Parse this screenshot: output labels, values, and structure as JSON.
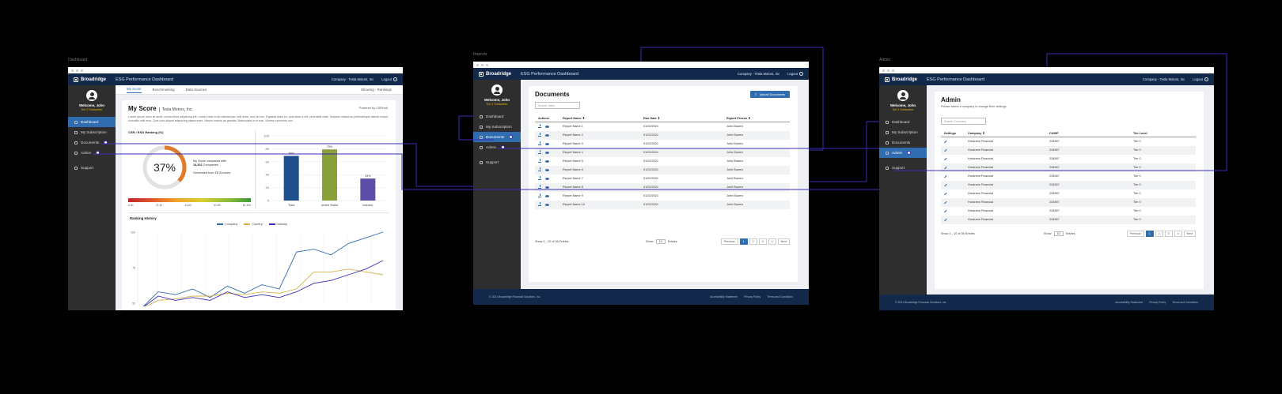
{
  "labels": {
    "dashboard": "Dashboard",
    "reports": "Reports",
    "admin": "Admin"
  },
  "app": {
    "brand": "Broadridge",
    "title": "ESG Performance Dashboard",
    "company_select": "Company - Tesla Motors, Inc",
    "logout": "Logout",
    "user_welcome": "Welcome, John",
    "user_tier": "Tier 2 Subscriber"
  },
  "sidebar": {
    "items": [
      {
        "label": "Dashboard",
        "icon": "dashboard-icon"
      },
      {
        "label": "My Subscription",
        "icon": "bell-icon"
      },
      {
        "label": "Documents",
        "icon": "document-icon"
      },
      {
        "label": "Admin",
        "icon": "gear-icon"
      },
      {
        "label": "Support",
        "icon": "phone-icon"
      }
    ]
  },
  "dashboard": {
    "tabs": [
      "My Score",
      "Benchmarking",
      "Data Sources"
    ],
    "showing": "Showing - Rankings",
    "title": "My Score",
    "company": "Tesla Motors, Inc.",
    "powered_by": "Powered by CSRHub",
    "lorem": "Lorem ipsum dolor sit amet, consectetur adipiscing elit. Lectus vitae id sit ullamcorper velit enim, sed vel nec. Egestas diam eu, quis diam a elit, venenatis vitae. Sodales massa ac pellentesque blandit neque, convallis velit eros. Quis duis aliquet adipiscing platea enim. Mauris mauris ac gravida. Malesuada in et erat. Viverra commodo orci.",
    "ranking_title": "CSR / ESG Ranking (%)",
    "score": "37%",
    "score_value": 37,
    "compared_line1": "My Score compared with",
    "compared_count": "18,302",
    "compared_line2": "Companies",
    "generated_prefix": "Generated from",
    "generated_count": "72",
    "generated_suffix": "Sources",
    "scale_ticks": [
      "0-20",
      "21-40",
      "41-60",
      "61-80",
      "81-100"
    ],
    "bars": {
      "categories": [
        "Tesla",
        "United States",
        "Industry"
      ],
      "values": [
        69,
        79,
        34
      ],
      "value_labels": [
        "69%",
        "79%",
        "34%"
      ],
      "colors": [
        "#1f4e8c",
        "#8aa13a",
        "#5b4fa8"
      ],
      "y_ticks": [
        "100",
        "80",
        "60",
        "40",
        "20",
        "0"
      ]
    },
    "history": {
      "title": "Ranking History",
      "legend": [
        "Company",
        "Country",
        "Industry"
      ],
      "colors": [
        "#2f6cb0",
        "#d4b24a",
        "#3a2db5"
      ],
      "y_ticks": [
        "100",
        "75",
        "50"
      ]
    }
  },
  "chart_data": [
    {
      "type": "bar",
      "title": "",
      "categories": [
        "Tesla",
        "United States",
        "Industry"
      ],
      "values": [
        69,
        79,
        34
      ],
      "ylim": [
        0,
        100
      ]
    },
    {
      "type": "line",
      "title": "Ranking History",
      "x": [
        0,
        1,
        2,
        3,
        4,
        5,
        6,
        7,
        8,
        9,
        10,
        11,
        12,
        13,
        14
      ],
      "series": [
        {
          "name": "Company",
          "values": [
            46,
            58,
            56,
            60,
            54,
            62,
            57,
            63,
            60,
            86,
            88,
            84,
            92,
            96,
            100
          ]
        },
        {
          "name": "Country",
          "values": [
            46,
            52,
            53,
            55,
            55,
            57,
            56,
            58,
            57,
            60,
            72,
            72,
            74,
            72,
            70
          ]
        },
        {
          "name": "Industry",
          "values": [
            46,
            55,
            52,
            54,
            52,
            58,
            54,
            56,
            54,
            58,
            64,
            66,
            70,
            74,
            80
          ]
        }
      ],
      "ylim": [
        50,
        100
      ]
    }
  ],
  "documents": {
    "title": "Documents",
    "search_placeholder": "Search Table",
    "upload": "Upload Documents",
    "columns": [
      "Actions",
      "Report Name",
      "Run Date",
      "Report Person"
    ],
    "rows": [
      [
        "Report Name 1",
        "01/22/2021",
        "John Bowen"
      ],
      [
        "Report Name 2",
        "01/22/2021",
        "John Bowen"
      ],
      [
        "Report Name 3",
        "01/22/2021",
        "John Bowen"
      ],
      [
        "Report Name 4",
        "01/22/2021",
        "John Bowen"
      ],
      [
        "Report Name 5",
        "01/22/2021",
        "John Bowen"
      ],
      [
        "Report Name 6",
        "01/22/2021",
        "John Bowen"
      ],
      [
        "Report Name 7",
        "01/22/2021",
        "John Bowen"
      ],
      [
        "Report Name 8",
        "01/22/2021",
        "John Bowen"
      ],
      [
        "Report Name 9",
        "01/22/2021",
        "John Bowen"
      ],
      [
        "Report Name 10",
        "01/22/2021",
        "John Bowen"
      ]
    ],
    "footer_count": "Show 1 - 10 of 36 Entries",
    "show_label": "Show",
    "show_value": "10",
    "entries_label": "Entries",
    "pager": [
      "Previous",
      "1",
      "2",
      "3",
      "4",
      "Next"
    ]
  },
  "admin": {
    "title": "Admin",
    "subtitle": "Please select a company to change their settings",
    "search_placeholder": "Search Company",
    "columns": [
      "Settings",
      "Company",
      "CUSIP",
      "Tier Level"
    ],
    "rows": [
      [
        "Hostcrew Financial",
        "234567",
        "Tier 0"
      ],
      [
        "Hostcrew Financial",
        "234567",
        "Tier 0"
      ],
      [
        "Hostcrew Financial",
        "234567",
        "Tier 0"
      ],
      [
        "Hostcrew Financial",
        "234567",
        "Tier 0"
      ],
      [
        "Hostcrew Financial",
        "234567",
        "Tier 0"
      ],
      [
        "Hostcrew Financial",
        "234567",
        "Tier 0"
      ],
      [
        "Hostcrew Financial",
        "234567",
        "Tier 0"
      ],
      [
        "Hostcrew Financial",
        "234567",
        "Tier 0"
      ],
      [
        "Hostcrew Financial",
        "234567",
        "Tier 0"
      ],
      [
        "Hostcrew Financial",
        "234567",
        "Tier 0"
      ]
    ],
    "footer_count": "Show 1 - 10 of 36 Entries",
    "show_label": "Show",
    "show_value": "10",
    "entries_label": "Entries",
    "pager": [
      "Previous",
      "1",
      "2",
      "3",
      "4",
      "Next"
    ]
  },
  "footer": {
    "copyright": "© 2021 Broadridge Financial Solutions, Inc.",
    "links": [
      "Accessibility Statement",
      "Privacy Policy",
      "Terms and Conditions"
    ]
  },
  "colors": {
    "navy": "#13294b",
    "accent": "#2f6cb0",
    "flow_line": "#3a2db5",
    "sidebar": "#2e2e2e"
  }
}
